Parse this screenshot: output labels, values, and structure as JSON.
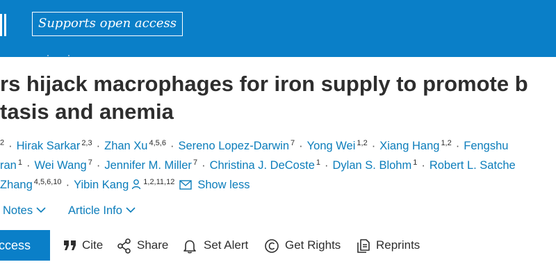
{
  "banner": {
    "open_access_label": "Supports open access",
    "bg_color": "#0a7fc8"
  },
  "article": {
    "title_line1": "rs hijack macrophages for iron supply to promote b",
    "title_line2": "tasis and anemia"
  },
  "authors": {
    "row1": [
      {
        "name": "",
        "sup": "2"
      },
      {
        "name": "Hirak Sarkar",
        "sup": "2,3"
      },
      {
        "name": "Zhan Xu",
        "sup": "4,5,6"
      },
      {
        "name": "Sereno Lopez-Darwin",
        "sup": "7"
      },
      {
        "name": "Yong Wei",
        "sup": "1,2"
      },
      {
        "name": "Xiang Hang",
        "sup": "1,2"
      },
      {
        "name": "Fengshu",
        "sup": ""
      }
    ],
    "row2": [
      {
        "name": "ran",
        "sup": "1"
      },
      {
        "name": "Wei Wang",
        "sup": "7"
      },
      {
        "name": "Jennifer M. Miller",
        "sup": "7"
      },
      {
        "name": "Christina J. DeCoste",
        "sup": "1"
      },
      {
        "name": "Dylan S. Blohm",
        "sup": "1"
      },
      {
        "name": "Robert L. Satche",
        "sup": ""
      }
    ],
    "row3": [
      {
        "name": "Zhang",
        "sup": "4,5,6,10"
      },
      {
        "name": "Yibin Kang",
        "sup": "1,2,11,12"
      }
    ],
    "show_less_label": "Show less",
    "link_color": "#0c7dbb"
  },
  "nav": {
    "notes_label": "Notes",
    "article_info_label": "Article Info"
  },
  "actions": {
    "access_label": "ccess",
    "cite_label": "Cite",
    "share_label": "Share",
    "set_alert_label": "Set Alert",
    "get_rights_label": "Get Rights",
    "reprints_label": "Reprints"
  }
}
